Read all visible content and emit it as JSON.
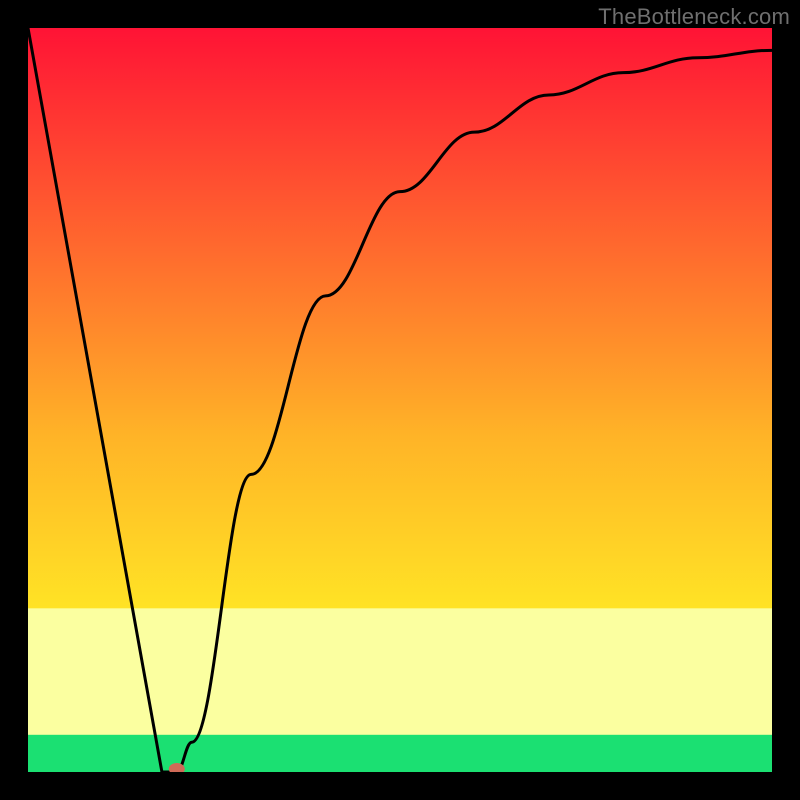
{
  "watermark": {
    "text": "TheBottleneck.com"
  },
  "chart_data": {
    "type": "line",
    "title": "",
    "xlabel": "",
    "ylabel": "",
    "xlim": [
      0,
      100
    ],
    "ylim": [
      0,
      100
    ],
    "grid": false,
    "legend": false,
    "series": [
      {
        "name": "curve",
        "color": "#000000",
        "x": [
          0,
          18,
          20,
          22,
          30,
          40,
          50,
          60,
          70,
          80,
          90,
          100
        ],
        "y": [
          100,
          0,
          0,
          4,
          40,
          64,
          78,
          86,
          91,
          94,
          96,
          97
        ]
      }
    ],
    "marker": {
      "x": 20,
      "y": 0,
      "color": "#cf6a57"
    },
    "bands": {
      "green_start_pct": 95,
      "green_end_pct": 100,
      "pale_yellow_start_pct": 78,
      "pale_yellow_end_pct": 95
    },
    "gradient_stops": [
      {
        "offset": 0,
        "color": "#ff1335"
      },
      {
        "offset": 25,
        "color": "#ff5c2f"
      },
      {
        "offset": 55,
        "color": "#ffb427"
      },
      {
        "offset": 78,
        "color": "#ffe325"
      },
      {
        "offset": 95,
        "color": "#fcff9a"
      },
      {
        "offset": 100,
        "color": "#1be072"
      }
    ]
  }
}
